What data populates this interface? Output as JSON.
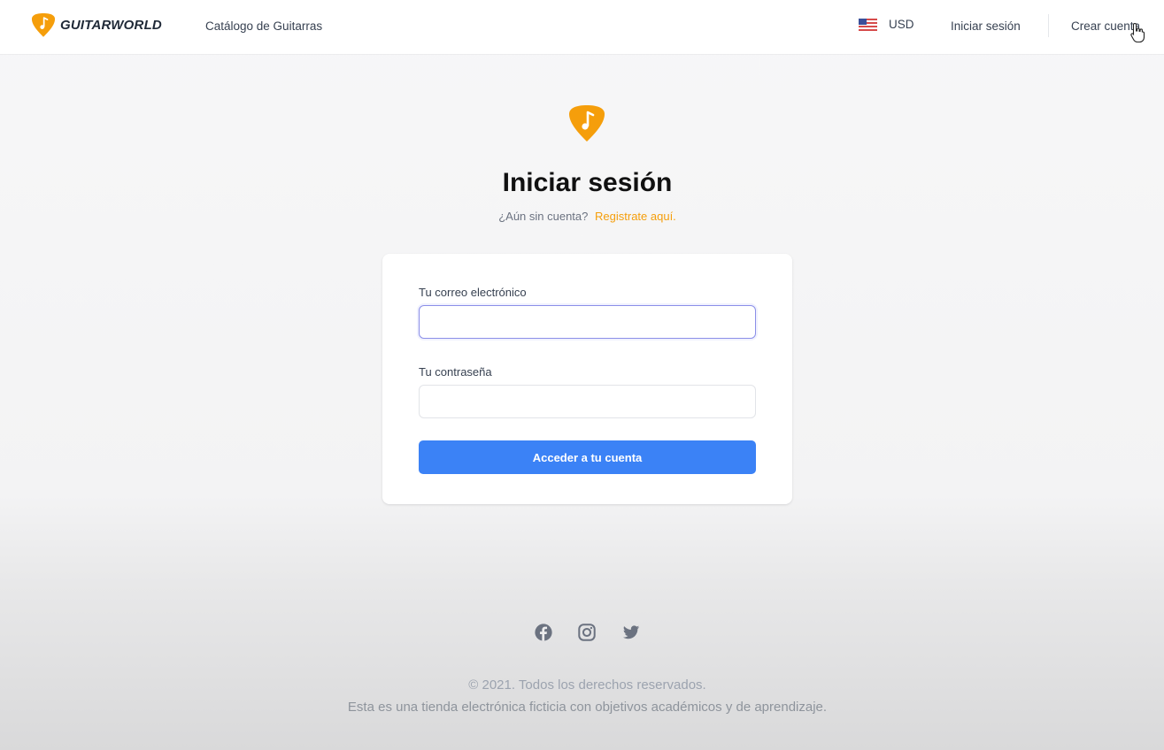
{
  "header": {
    "brand": "GUITARWORLD",
    "nav": {
      "catalog": "Catálogo de Guitarras",
      "login": "Iniciar sesión",
      "register": "Crear cuenta"
    },
    "currency": {
      "code": "USD",
      "flag_icon": "us-flag-icon"
    }
  },
  "main": {
    "title": "Iniciar sesión",
    "subtitle": {
      "prompt": "¿Aún sin cuenta?",
      "link": "Registrate aquí."
    }
  },
  "form": {
    "email": {
      "label": "Tu correo electrónico",
      "value": ""
    },
    "password": {
      "label": "Tu contraseña",
      "value": ""
    },
    "submit": "Acceder a tu cuenta"
  },
  "footer": {
    "social_icons": [
      "facebook-icon",
      "instagram-icon",
      "twitter-icon"
    ],
    "copyright": "© 2021. Todos los derechos reservados.",
    "disclaimer": "Esta es una tienda electrónica ficticia con objetivos académicos y de aprendizaje."
  },
  "colors": {
    "brand_orange": "#f59e0b",
    "primary_blue": "#3b82f6",
    "focus_border": "#8b8fe8"
  }
}
